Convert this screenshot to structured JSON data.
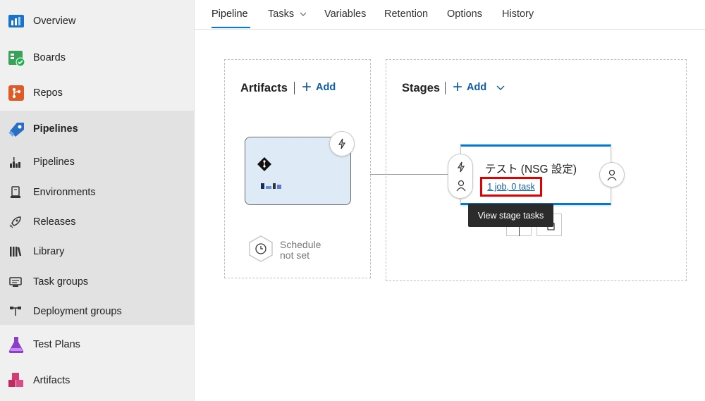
{
  "sidebar": {
    "items": [
      {
        "label": "Overview",
        "icon": "overview-icon"
      },
      {
        "label": "Boards",
        "icon": "boards-icon"
      },
      {
        "label": "Repos",
        "icon": "repos-icon"
      },
      {
        "label": "Pipelines",
        "icon": "pipelines-icon"
      },
      {
        "label": "Pipelines",
        "icon": "pipelines-sub-icon"
      },
      {
        "label": "Environments",
        "icon": "environments-icon"
      },
      {
        "label": "Releases",
        "icon": "rocket-icon"
      },
      {
        "label": "Library",
        "icon": "library-icon"
      },
      {
        "label": "Task groups",
        "icon": "task-groups-icon"
      },
      {
        "label": "Deployment groups",
        "icon": "deployment-groups-icon"
      },
      {
        "label": "Test Plans",
        "icon": "test-plans-icon"
      },
      {
        "label": "Artifacts",
        "icon": "artifacts-icon"
      }
    ]
  },
  "tabs": [
    {
      "label": "Pipeline"
    },
    {
      "label": "Tasks"
    },
    {
      "label": "Variables"
    },
    {
      "label": "Retention"
    },
    {
      "label": "Options"
    },
    {
      "label": "History"
    }
  ],
  "artifacts_panel": {
    "title": "Artifacts",
    "add_label": "Add",
    "schedule_line1": "Schedule",
    "schedule_line2": "not set"
  },
  "stages_panel": {
    "title": "Stages",
    "add_label": "Add",
    "stage": {
      "name": "テスト (NSG 設定)",
      "tasks_link": "1 job, 0 task"
    },
    "tooltip": "View stage tasks"
  },
  "colors": {
    "accent": "#0078d4",
    "link": "#0f5ca8",
    "highlight": "#e00000"
  }
}
